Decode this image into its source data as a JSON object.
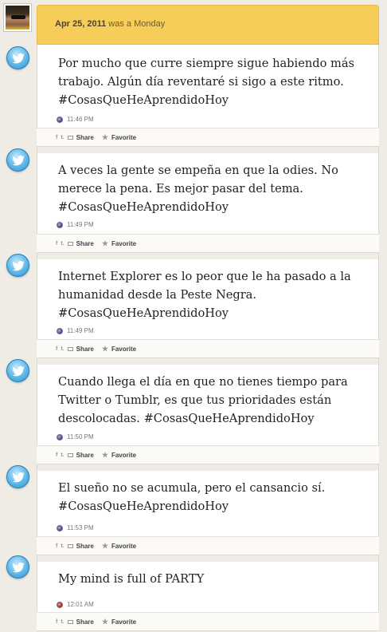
{
  "header": {
    "date": "Apr 25, 2011",
    "weekday_text": "was a Monday"
  },
  "actions": {
    "share_label": "Share",
    "favorite_label": "Favorite",
    "facebook_glyph": "f",
    "twitter_glyph": "t."
  },
  "posts": [
    {
      "text": "Por mucho que curre siempre sigue habiendo más trabajo. Algún día reventaré si sigo a este ritmo. #CosasQueHeAprendidoHoy",
      "time": "11:46 PM"
    },
    {
      "text": "A veces la gente se empeña en que la odies. No merece la pena. Es mejor pasar del tema. #CosasQueHeAprendidoHoy",
      "time": "11:49 PM"
    },
    {
      "text": "Internet Explorer es lo peor que le ha pasado a la humanidad desde la Peste Negra. #CosasQueHeAprendidoHoy",
      "time": "11:49 PM"
    },
    {
      "text": "Cuando llega el día en que no tienes tiempo para Twitter o Tumblr, es que tus prioridades están descolocadas. #CosasQueHeAprendidoHoy",
      "time": "11:50 PM"
    },
    {
      "text": "El sueño no se acumula, pero el cansancio sí. #CosasQueHeAprendidoHoy",
      "time": "11:53 PM"
    },
    {
      "text": "My mind is full of PARTY",
      "time": "12:01 AM"
    }
  ],
  "colors": {
    "header_bg": "#f7cd5a",
    "page_bg": "#efece6",
    "twitter_blue": "#5eb8ea"
  }
}
